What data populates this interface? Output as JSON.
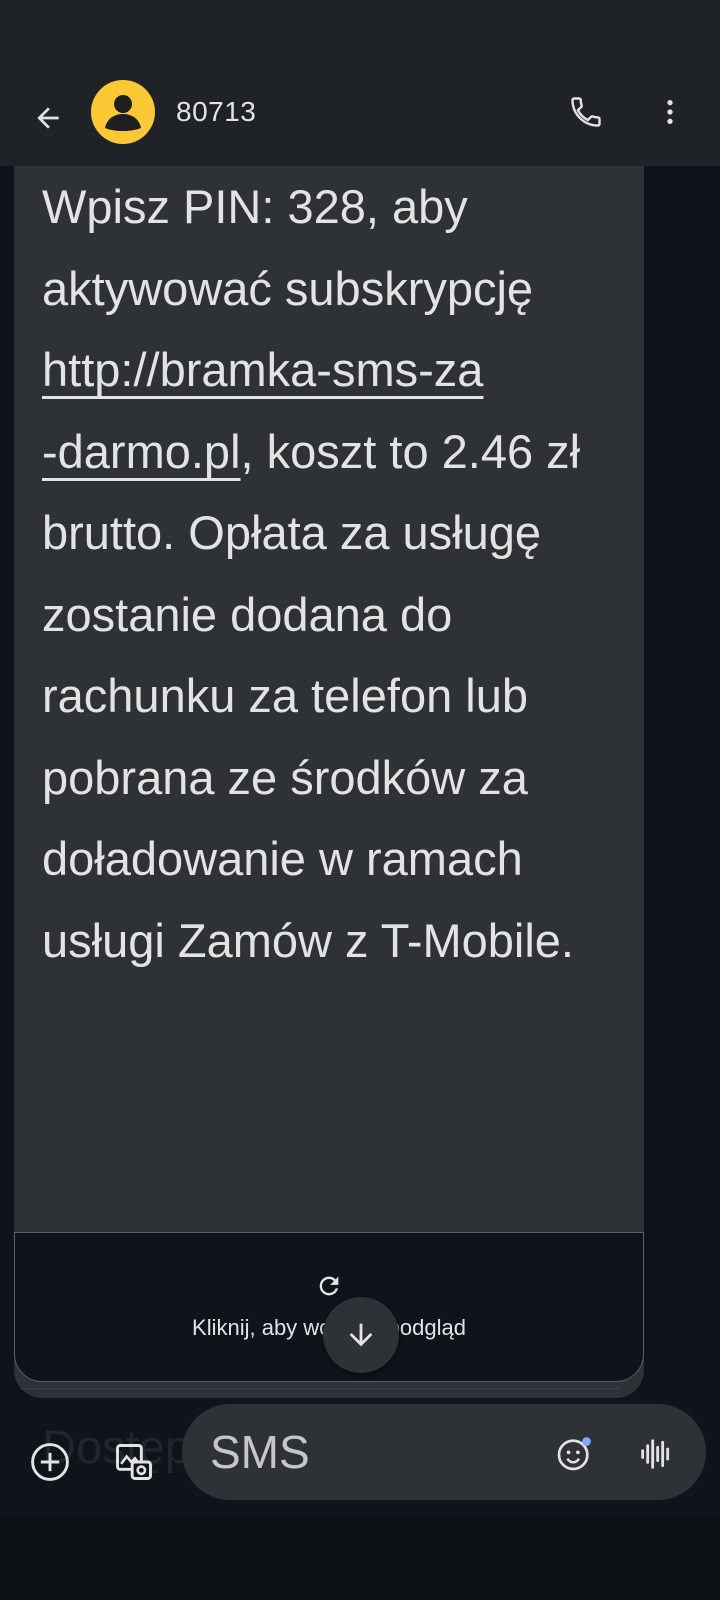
{
  "header": {
    "contact_name": "80713",
    "back_icon": "arrow-back-icon",
    "avatar_icon": "person-icon",
    "call_icon": "phone-icon",
    "more_icon": "more-vert-icon"
  },
  "message": {
    "text_before_link": "Wpisz PIN: 328, aby aktywować subskrypcję ",
    "link_line1": "http://bramka-sms-za",
    "link_line2": "-darmo.pl",
    "text_after_link": ", koszt to 2.46 zł brutto. Opłata za usługę zostanie dodana do rachunku za telefon lub pobrana ze środków za doładowanie w ramach usługi Zamów z T-Mobile."
  },
  "link_preview": {
    "label": "Kliknij, aby wczytać podgląd",
    "icon": "refresh-icon"
  },
  "next_message_fragment": "Dostęp http://bramka-sms-za",
  "compose": {
    "placeholder": "SMS",
    "add_icon": "add-circle-icon",
    "gallery_icon": "gallery-icon",
    "emoji_icon": "emoji-icon",
    "voice_icon": "voice-icon"
  },
  "scroll_icon": "arrow-down-icon",
  "colors": {
    "background": "#0f141a",
    "bubble": "#2e3135",
    "avatar": "#fcc934",
    "text": "#e3e3e3"
  }
}
